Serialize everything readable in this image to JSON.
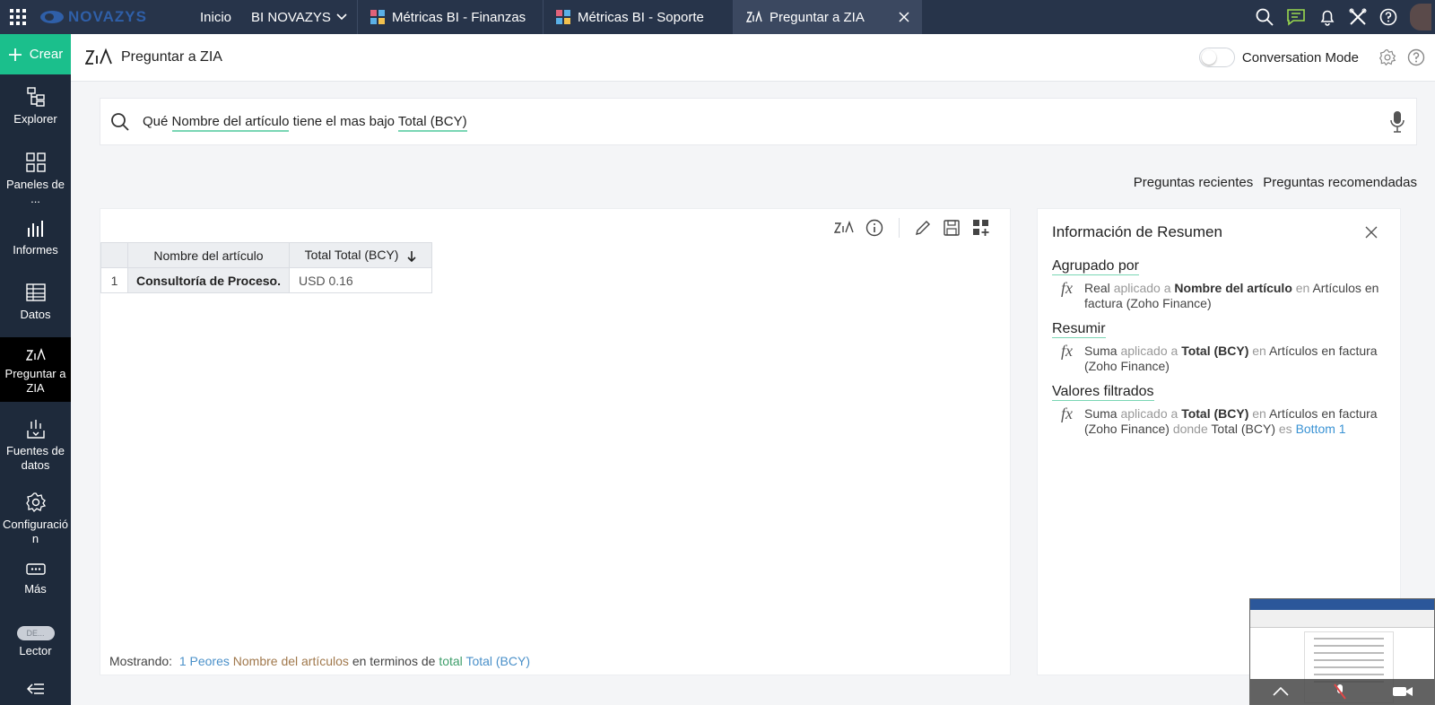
{
  "topbar": {
    "logo_text": "NOVAZYS",
    "home_label": "Inicio",
    "workspace_label": "BI NOVAZYS",
    "tabs": [
      {
        "label": "Métricas BI - Finanzas"
      },
      {
        "label": "Métricas BI - Soporte"
      },
      {
        "label": "Preguntar a ZIA"
      }
    ]
  },
  "sidebar": {
    "create_label": "Crear",
    "items": [
      {
        "label": "Explorer"
      },
      {
        "label": "Paneles de ..."
      },
      {
        "label": "Informes"
      },
      {
        "label": "Datos"
      },
      {
        "label": "Preguntar a ZIA"
      },
      {
        "label": "Fuentes de datos"
      },
      {
        "label": "Configuración"
      },
      {
        "label": "Más"
      },
      {
        "label": "Lector"
      }
    ],
    "lector_toggle": "DE..."
  },
  "header": {
    "title": "Preguntar a ZIA",
    "conversation_mode": "Conversation Mode"
  },
  "search": {
    "w1": "Qué",
    "t1": "Nombre del artículo",
    "w2": "tiene el mas bajo",
    "t2": "Total (BCY)"
  },
  "links": {
    "recent": "Preguntas recientes",
    "recommended": "Preguntas recomendadas"
  },
  "result": {
    "columns": [
      "Nombre del artículo",
      "Total Total (BCY)"
    ],
    "rows": [
      {
        "index": "1",
        "name": "Consultoría de Proceso.",
        "value": "USD 0.16"
      }
    ],
    "footer": {
      "prefix": "Mostrando:",
      "count": "1 Peores",
      "field": "Nombre del artículos",
      "mid": "en terminos de",
      "agg": "total",
      "measure": "Total (BCY)"
    }
  },
  "summary": {
    "title": "Información de Resumen",
    "grouped_by": {
      "heading": "Agrupado por",
      "fn": "Real",
      "applied": "aplicado a",
      "field": "Nombre del artículo",
      "in": "en",
      "table": "Artículos en factura (Zoho Finance)"
    },
    "summarize": {
      "heading": "Resumir",
      "fn": "Suma",
      "applied": "aplicado a",
      "field": "Total (BCY)",
      "in": "en",
      "table": "Artículos en factura (Zoho Finance)"
    },
    "filtered": {
      "heading": "Valores filtrados",
      "fn": "Suma",
      "applied": "aplicado a",
      "field": "Total (BCY)",
      "in": "en",
      "table": "Artículos en factura (Zoho Finance)",
      "where": "donde",
      "cond_field": "Total (BCY)",
      "is": "es",
      "value": "Bottom 1"
    }
  },
  "colors": {
    "topbar": "#27344a",
    "sidebar": "#1e2a3b",
    "accent_green": "#1bbf8c",
    "link_blue": "#3a93d4"
  }
}
